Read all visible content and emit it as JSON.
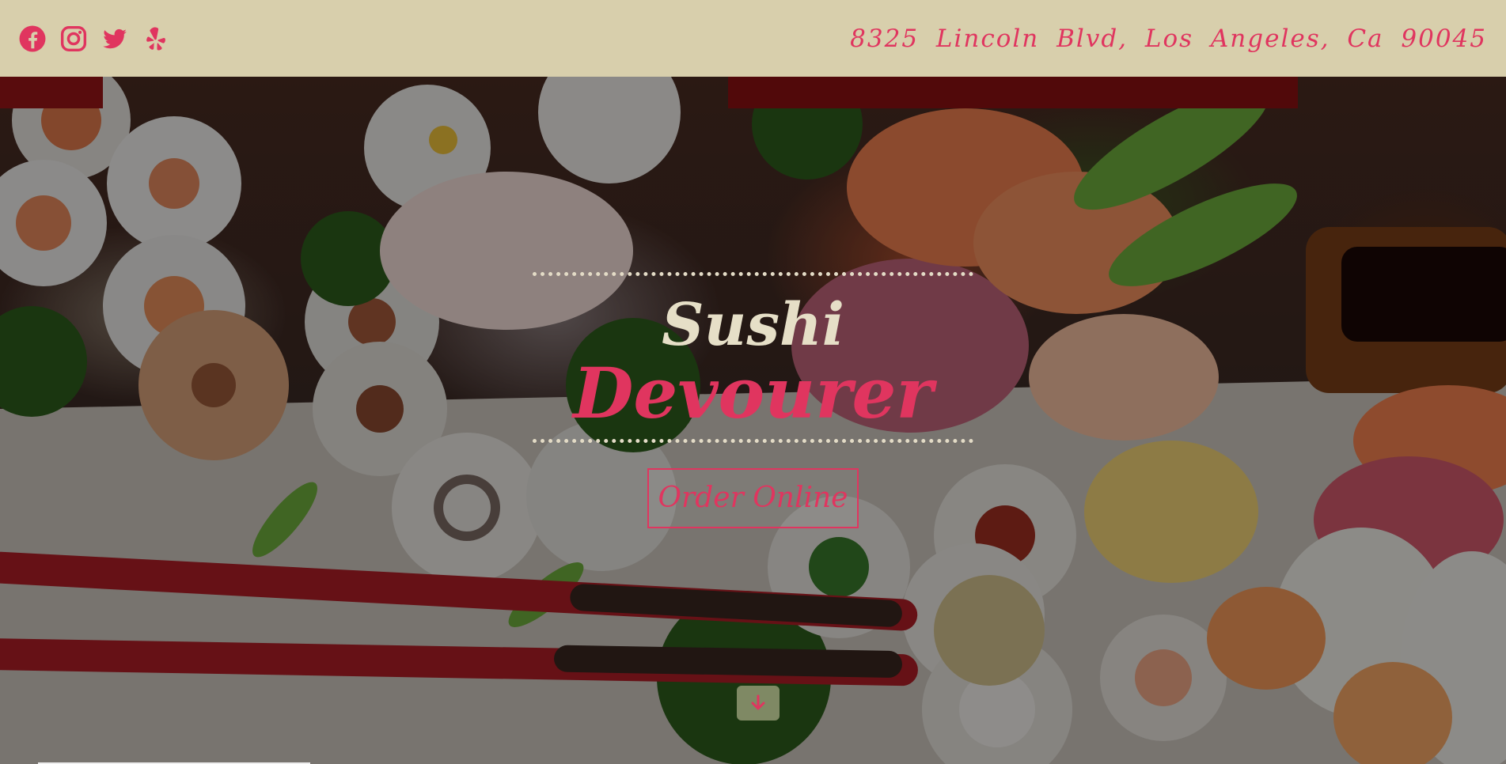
{
  "colors": {
    "topbar_bg": "#d8cfac",
    "accent": "#e0355f",
    "cream": "#e6dfc7"
  },
  "social": [
    {
      "icon": "facebook-icon"
    },
    {
      "icon": "instagram-icon"
    },
    {
      "icon": "twitter-icon"
    },
    {
      "icon": "yelp-icon"
    }
  ],
  "header": {
    "address": "8325 Lincoln Blvd, Los Angeles, Ca 90045"
  },
  "hero": {
    "title_line1": "Sushi",
    "title_line2": "Devourer",
    "cta_label": "Order Online",
    "scroll_icon": "arrow-down-icon"
  }
}
